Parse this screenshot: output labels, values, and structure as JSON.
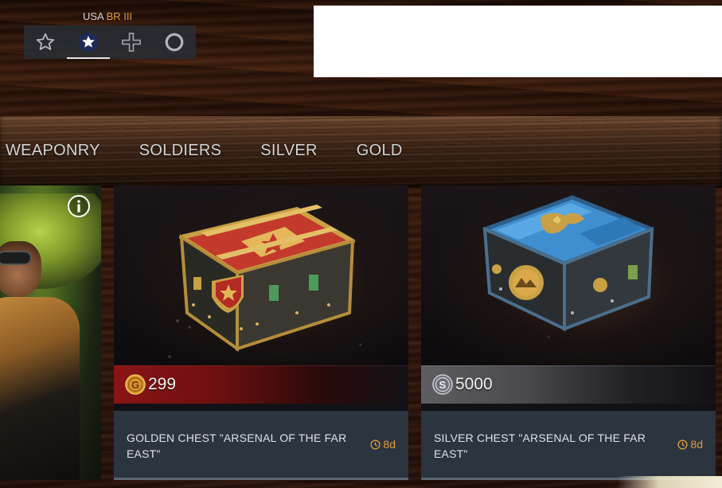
{
  "nation": {
    "country": "USA",
    "br": "BR III",
    "buttons": [
      {
        "name": "star-outline-icon",
        "active": false
      },
      {
        "name": "usa-star-roundel-icon",
        "active": true
      },
      {
        "name": "german-cross-icon",
        "active": false
      },
      {
        "name": "ring-icon",
        "active": false
      }
    ]
  },
  "tabs": [
    "WEAPONRY",
    "SOLDIERS",
    "SILVER",
    "GOLD"
  ],
  "cards": [
    {
      "title": "GOLDEN CHEST \"ARSENAL OF THE FAR EAST\"",
      "price": "299",
      "currency_icon": "gold-coin-icon",
      "timer": "8d",
      "timer_icon": "clock-icon"
    },
    {
      "title": "SILVER CHEST \"ARSENAL OF THE FAR EAST\"",
      "price": "5000",
      "currency_icon": "silver-coin-icon",
      "timer": "8d",
      "timer_icon": "clock-icon"
    }
  ],
  "colors": {
    "accent_orange": "#e0a038",
    "gold_strip": "#8a1414",
    "silver_strip": "#5e5e62",
    "card_info_bg": "#2c3440"
  }
}
